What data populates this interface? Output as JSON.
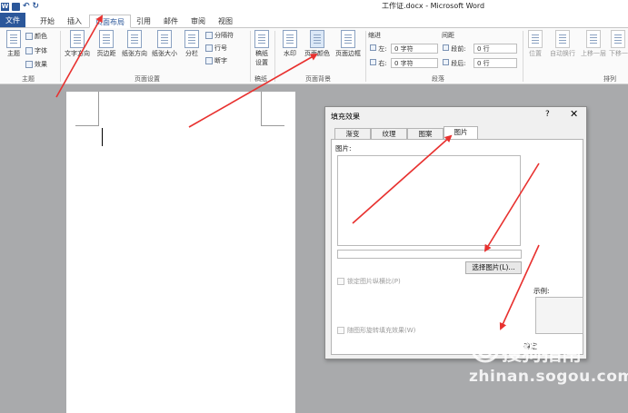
{
  "window": {
    "title": "工作证.docx - Microsoft Word",
    "app_icon": "W"
  },
  "tabs": [
    "文件",
    "开始",
    "插入",
    "页面布局",
    "引用",
    "邮件",
    "审阅",
    "视图"
  ],
  "ribbon": {
    "theme": {
      "big": "主题",
      "colors": "颜色",
      "fonts": "字体",
      "effects": "效果",
      "group": "主题"
    },
    "page_setup": {
      "buttons": [
        "文字方向",
        "页边距",
        "纸张方向",
        "纸张大小",
        "分栏"
      ],
      "side": [
        "分隔符",
        "行号",
        "断字"
      ],
      "group": "页面设置"
    },
    "draft": {
      "label1": "稿纸",
      "label2": "设置",
      "group": "稿纸"
    },
    "background": {
      "buttons": [
        "水印",
        "页面颜色",
        "页面边框"
      ],
      "group": "页面背景"
    },
    "paragraph": {
      "indent": "缩进",
      "spacing": "间距",
      "left": "左:",
      "right": "右:",
      "before": "段前:",
      "after": "段后:",
      "left_val": "0 字符",
      "right_val": "0 字符",
      "before_val": "0 行",
      "after_val": "0 行",
      "group": "段落"
    },
    "arrange": {
      "buttons": [
        "位置",
        "自动换行",
        "上移一层",
        "下移一"
      ],
      "group": "排列"
    }
  },
  "dialog": {
    "title": "填充效果",
    "help": "?",
    "close": "✕",
    "tabs": [
      "渐变",
      "纹理",
      "图案",
      "图片"
    ],
    "active_tab": 3,
    "picture_label": "图片:",
    "select_button": "选择图片(L)...",
    "lock_aspect": "锁定图片纵横比(P)",
    "rotate_with_shape": "随图形旋转填充效果(W)",
    "sample_label": "示例:",
    "ok_partial": "确定"
  },
  "watermark": {
    "brand": "搜狗指南",
    "url": "zhinan.sogou.com"
  },
  "colors": {
    "accent": "#2b579a",
    "arrow": "#e8312f",
    "background": "#a9aaac"
  }
}
